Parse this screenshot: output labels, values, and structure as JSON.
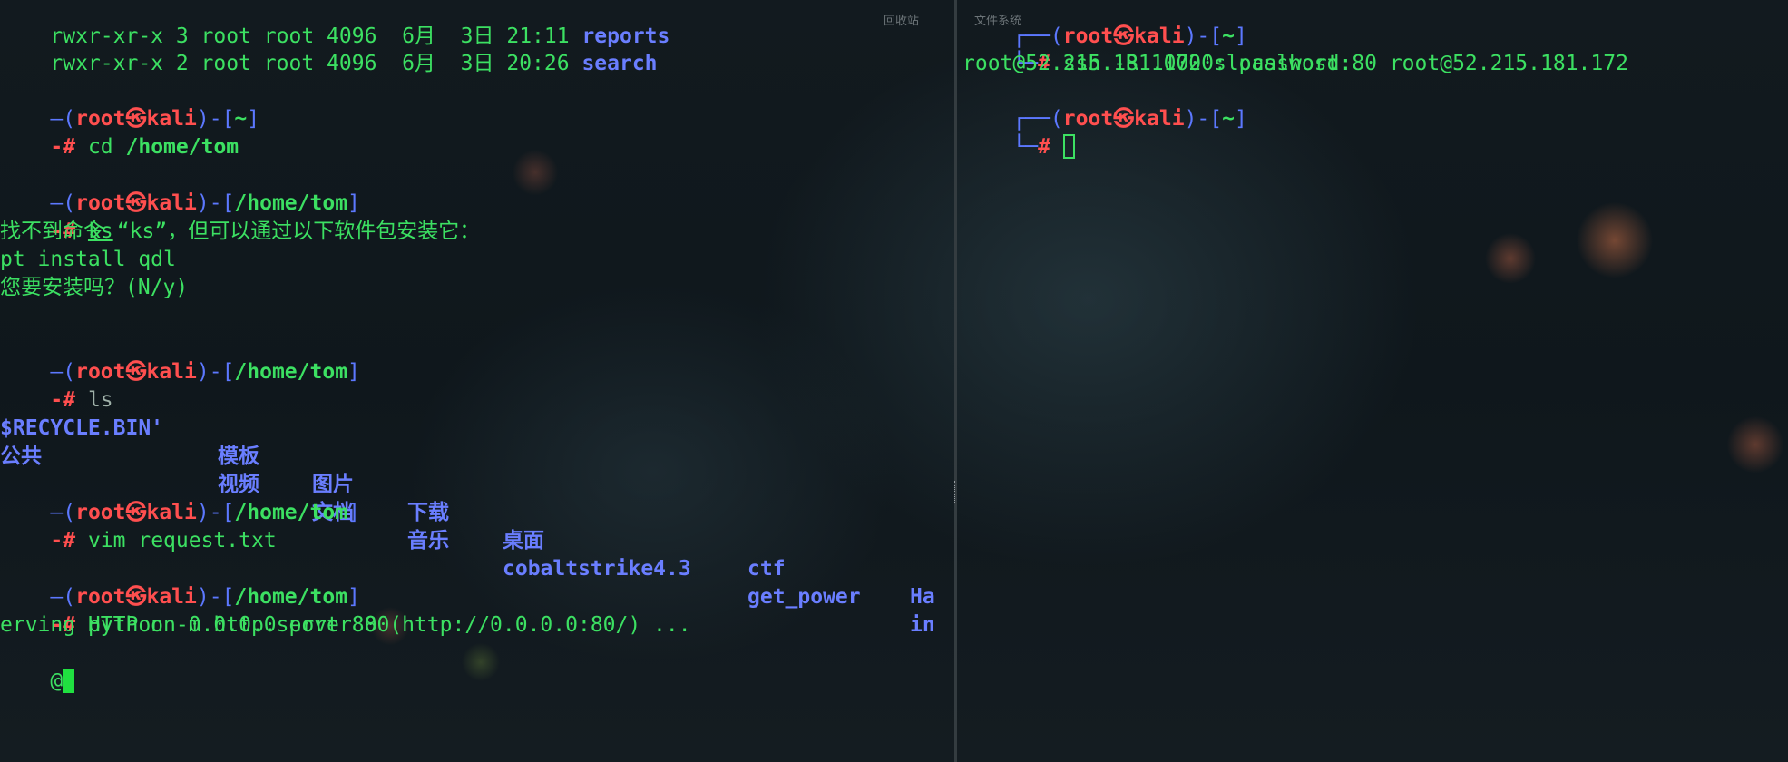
{
  "left_pane": {
    "ls_rows": [
      {
        "perms": "rwxr-xr-x 3 root root 4096  6月  3日 21:11 ",
        "name": "reports"
      },
      {
        "perms": "rwxr-xr-x 2 root root 4096  6月  3日 20:26 ",
        "name": "search"
      }
    ],
    "prompt": {
      "open": "—(",
      "user": "root",
      "at": "㉿",
      "host": "kali",
      "mid": ")-[",
      "close": "]"
    },
    "blocks": [
      {
        "cwd": "~",
        "hash": "-#",
        "cmd": "cd",
        "arg": "/home/tom"
      },
      {
        "cwd": "/home/tom",
        "hash": "-#",
        "cmd": "ks",
        "arg": ""
      },
      {
        "cwd": "/home/tom",
        "hash": "-#",
        "cmd": "ls",
        "arg": ""
      },
      {
        "cwd": "/home/tom",
        "hash": "-#",
        "cmd": "vim request.txt",
        "arg": ""
      },
      {
        "cwd": "/home/tom",
        "hash": "-#",
        "cmd": "python -m http.server 80",
        "arg": ""
      }
    ],
    "ks_output": [
      "找不到命令 “ks”，但可以通过以下软件包安装它：",
      "pt install qdl",
      "您要安装吗？(N/y)"
    ],
    "ls_output": {
      "row1": [
        "$RECYCLE.BIN'",
        "模板",
        "图片",
        "下载",
        "桌面",
        "ctf",
        "Ha"
      ],
      "row2": [
        "公共",
        "视频",
        "文档",
        "音乐",
        "cobaltstrike4.3",
        "get_power",
        "in"
      ]
    },
    "server_output": "erving HTTP on 0.0.0.0 port 80 (http://0.0.0.0:80/) ...",
    "last_line": "@"
  },
  "right_pane": {
    "prompt_top_cwd": "~",
    "ssh_cmd": "ssh -R 10000:localhost:80 root@52.215.181.172",
    "password_prompt": "root@52.215.181.172's password:",
    "prompt_cwd": "~",
    "hash": "#"
  },
  "desktop": {
    "recycle_label": "回收站",
    "fs_label": "文件系统"
  }
}
